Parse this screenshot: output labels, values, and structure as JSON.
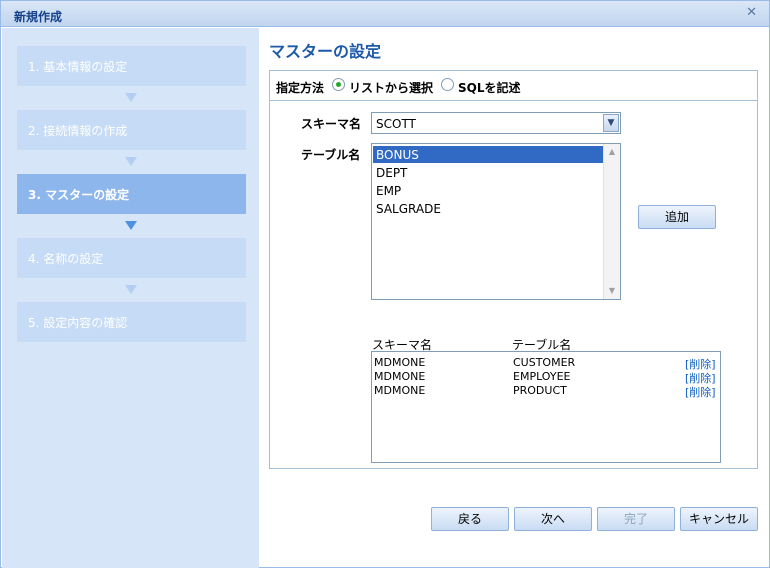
{
  "window": {
    "title": "新規作成"
  },
  "steps": [
    {
      "label": "1. 基本情報の設定"
    },
    {
      "label": "2. 接続情報の作成"
    },
    {
      "label": "3. マスターの設定"
    },
    {
      "label": "4. 名称の設定"
    },
    {
      "label": "5. 設定内容の確認"
    }
  ],
  "active_step": 3,
  "page": {
    "heading": "マスターの設定"
  },
  "method": {
    "label": "指定方法",
    "options": [
      "リストから選択",
      "SQLを記述"
    ],
    "selected": "リストから選択"
  },
  "schema": {
    "label": "スキーマ名",
    "value": "SCOTT"
  },
  "tables": {
    "label": "テーブル名",
    "items": [
      "BONUS",
      "DEPT",
      "EMP",
      "SALGRADE"
    ],
    "selected": "BONUS"
  },
  "add_button": "追加",
  "selected_table": {
    "headers": [
      "スキーマ名",
      "テーブル名"
    ],
    "rows": [
      {
        "schema": "MDMONE",
        "table": "CUSTOMER",
        "action": "[削除]"
      },
      {
        "schema": "MDMONE",
        "table": "EMPLOYEE",
        "action": "[削除]"
      },
      {
        "schema": "MDMONE",
        "table": "PRODUCT",
        "action": "[削除]"
      }
    ]
  },
  "footer": {
    "back": "戻る",
    "next": "次へ",
    "finish": "完了",
    "cancel": "キャンセル"
  }
}
